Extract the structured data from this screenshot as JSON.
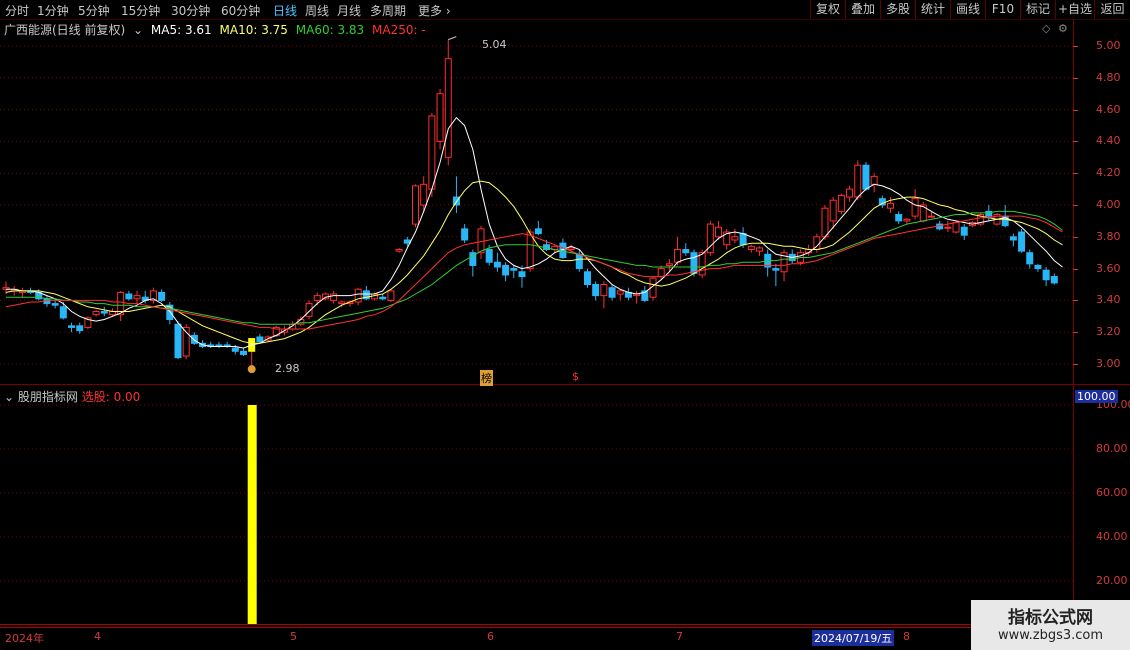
{
  "toolbar": {
    "periods": [
      "分时",
      "1分钟",
      "5分钟",
      "15分钟",
      "30分钟",
      "60分钟",
      "日线",
      "周线",
      "月线",
      "多周期",
      "更多"
    ],
    "active_period": "日线",
    "buttons": [
      "复权",
      "叠加",
      "多股",
      "统计",
      "画线",
      "F10",
      "标记",
      "+自选",
      "返回"
    ]
  },
  "header": {
    "stock": "广西能源(日线 前复权)",
    "ma5": "MA5: 3.61",
    "ma10": "MA10: 3.75",
    "ma60": "MA60: 3.83",
    "ma250": "MA250: -"
  },
  "colors": {
    "up": "#ff2d2d",
    "down": "#29b6f6",
    "ma5": "#ffffff",
    "ma10": "#ffff66",
    "ma60": "#33cc33",
    "ma250": "#ff3030",
    "axis": "#d23c3c",
    "signal": "#ffff00"
  },
  "main_chart": {
    "y_ticks": [
      "5.00",
      "4.80",
      "4.60",
      "4.40",
      "4.20",
      "4.00",
      "3.80",
      "3.60",
      "3.40",
      "3.20",
      "3.00"
    ],
    "high_label": "5.04",
    "low_label": "2.98",
    "markers": [
      "榜",
      "$"
    ]
  },
  "indicator": {
    "name": "股朋指标网",
    "value": "选股: 0.00",
    "current_badge": "100.00",
    "y_ticks": [
      "100.00",
      "80.00",
      "60.00",
      "40.00",
      "20.00"
    ]
  },
  "x_axis": {
    "labels": [
      "2024年",
      "4",
      "5",
      "6",
      "7",
      "8"
    ],
    "cursor_date": "2024/07/19/五"
  },
  "watermark": {
    "line1": "指标公式网",
    "line2": "www.zbgs3.com"
  },
  "chart_data": {
    "type": "candlestick",
    "ylim": [
      2.95,
      5.1
    ],
    "ohlc": [
      [
        3.47,
        3.52,
        3.44,
        3.48
      ],
      [
        3.46,
        3.49,
        3.43,
        3.47
      ],
      [
        3.45,
        3.48,
        3.42,
        3.46
      ],
      [
        3.46,
        3.48,
        3.44,
        3.45
      ],
      [
        3.45,
        3.47,
        3.4,
        3.41
      ],
      [
        3.41,
        3.43,
        3.36,
        3.38
      ],
      [
        3.38,
        3.41,
        3.35,
        3.37
      ],
      [
        3.36,
        3.39,
        3.28,
        3.29
      ],
      [
        3.24,
        3.26,
        3.2,
        3.23
      ],
      [
        3.24,
        3.26,
        3.19,
        3.21
      ],
      [
        3.23,
        3.3,
        3.22,
        3.29
      ],
      [
        3.31,
        3.34,
        3.3,
        3.33
      ],
      [
        3.33,
        3.36,
        3.3,
        3.32
      ],
      [
        3.31,
        3.35,
        3.3,
        3.33
      ],
      [
        3.31,
        3.46,
        3.27,
        3.45
      ],
      [
        3.44,
        3.46,
        3.4,
        3.41
      ],
      [
        3.41,
        3.46,
        3.38,
        3.43
      ],
      [
        3.42,
        3.46,
        3.38,
        3.4
      ],
      [
        3.4,
        3.48,
        3.38,
        3.46
      ],
      [
        3.45,
        3.47,
        3.39,
        3.4
      ],
      [
        3.37,
        3.39,
        3.25,
        3.28
      ],
      [
        3.25,
        3.27,
        3.03,
        3.04
      ],
      [
        3.05,
        3.25,
        3.03,
        3.23
      ],
      [
        3.18,
        3.2,
        3.12,
        3.13
      ],
      [
        3.13,
        3.15,
        3.1,
        3.11
      ],
      [
        3.12,
        3.14,
        3.1,
        3.11
      ],
      [
        3.12,
        3.14,
        3.1,
        3.11
      ],
      [
        3.12,
        3.14,
        3.1,
        3.11
      ],
      [
        3.1,
        3.12,
        3.06,
        3.08
      ],
      [
        3.08,
        3.1,
        3.05,
        3.06
      ],
      [
        3.08,
        3.16,
        2.98,
        3.16
      ],
      [
        3.17,
        3.19,
        3.13,
        3.14
      ],
      [
        3.15,
        3.18,
        3.14,
        3.17
      ],
      [
        3.18,
        3.24,
        3.17,
        3.23
      ],
      [
        3.2,
        3.24,
        3.18,
        3.22
      ],
      [
        3.22,
        3.27,
        3.21,
        3.25
      ],
      [
        3.25,
        3.3,
        3.24,
        3.28
      ],
      [
        3.3,
        3.4,
        3.28,
        3.38
      ],
      [
        3.4,
        3.45,
        3.37,
        3.43
      ],
      [
        3.41,
        3.45,
        3.4,
        3.44
      ],
      [
        3.4,
        3.46,
        3.38,
        3.44
      ],
      [
        3.38,
        3.4,
        3.36,
        3.39
      ],
      [
        3.38,
        3.4,
        3.36,
        3.39
      ],
      [
        3.39,
        3.48,
        3.37,
        3.47
      ],
      [
        3.46,
        3.49,
        3.4,
        3.41
      ],
      [
        3.41,
        3.45,
        3.4,
        3.44
      ],
      [
        3.42,
        3.44,
        3.4,
        3.41
      ],
      [
        3.4,
        3.47,
        3.39,
        3.46
      ],
      [
        3.71,
        3.73,
        3.7,
        3.72
      ],
      [
        3.78,
        3.8,
        3.74,
        3.76
      ],
      [
        3.88,
        4.13,
        3.86,
        4.12
      ],
      [
        4.0,
        4.18,
        3.95,
        4.13
      ],
      [
        4.1,
        4.58,
        4.05,
        4.56
      ],
      [
        4.4,
        4.73,
        4.35,
        4.7
      ],
      [
        4.3,
        5.04,
        4.25,
        4.92
      ],
      [
        4.05,
        4.18,
        3.95,
        4.0
      ],
      [
        3.85,
        3.88,
        3.76,
        3.78
      ],
      [
        3.7,
        3.72,
        3.55,
        3.62
      ],
      [
        3.7,
        3.87,
        3.66,
        3.85
      ],
      [
        3.72,
        3.75,
        3.62,
        3.64
      ],
      [
        3.64,
        3.7,
        3.58,
        3.61
      ],
      [
        3.62,
        3.64,
        3.52,
        3.56
      ],
      [
        3.6,
        3.62,
        3.54,
        3.59
      ],
      [
        3.58,
        3.62,
        3.48,
        3.55
      ],
      [
        3.6,
        3.85,
        3.58,
        3.83
      ],
      [
        3.85,
        3.9,
        3.81,
        3.82
      ],
      [
        3.75,
        3.78,
        3.71,
        3.72
      ],
      [
        3.72,
        3.75,
        3.7,
        3.74
      ],
      [
        3.76,
        3.79,
        3.66,
        3.67
      ],
      [
        3.72,
        3.75,
        3.7,
        3.73
      ],
      [
        3.69,
        3.72,
        3.58,
        3.6
      ],
      [
        3.58,
        3.6,
        3.48,
        3.5
      ],
      [
        3.5,
        3.52,
        3.4,
        3.43
      ],
      [
        3.43,
        3.52,
        3.35,
        3.5
      ],
      [
        3.48,
        3.5,
        3.4,
        3.42
      ],
      [
        3.44,
        3.47,
        3.4,
        3.46
      ],
      [
        3.45,
        3.48,
        3.4,
        3.42
      ],
      [
        3.43,
        3.46,
        3.38,
        3.44
      ],
      [
        3.46,
        3.49,
        3.39,
        3.4
      ],
      [
        3.42,
        3.55,
        3.4,
        3.54
      ],
      [
        3.55,
        3.62,
        3.53,
        3.6
      ],
      [
        3.62,
        3.66,
        3.58,
        3.63
      ],
      [
        3.64,
        3.8,
        3.62,
        3.72
      ],
      [
        3.72,
        3.76,
        3.68,
        3.7
      ],
      [
        3.7,
        3.72,
        3.55,
        3.57
      ],
      [
        3.56,
        3.72,
        3.54,
        3.7
      ],
      [
        3.7,
        3.9,
        3.68,
        3.88
      ],
      [
        3.8,
        3.9,
        3.78,
        3.86
      ],
      [
        3.75,
        3.85,
        3.72,
        3.83
      ],
      [
        3.78,
        3.85,
        3.76,
        3.8
      ],
      [
        3.82,
        3.86,
        3.73,
        3.75
      ],
      [
        3.72,
        3.75,
        3.7,
        3.74
      ],
      [
        3.71,
        3.74,
        3.68,
        3.73
      ],
      [
        3.69,
        3.72,
        3.55,
        3.61
      ],
      [
        3.6,
        3.63,
        3.49,
        3.59
      ],
      [
        3.58,
        3.72,
        3.52,
        3.7
      ],
      [
        3.69,
        3.72,
        3.63,
        3.65
      ],
      [
        3.64,
        3.72,
        3.62,
        3.7
      ],
      [
        3.7,
        3.75,
        3.68,
        3.72
      ],
      [
        3.72,
        3.82,
        3.7,
        3.8
      ],
      [
        3.8,
        4.0,
        3.78,
        3.98
      ],
      [
        3.9,
        4.05,
        3.85,
        4.03
      ],
      [
        3.96,
        4.07,
        3.94,
        4.06
      ],
      [
        4.05,
        4.12,
        4.02,
        4.1
      ],
      [
        4.05,
        4.28,
        4.03,
        4.25
      ],
      [
        4.25,
        4.27,
        4.09,
        4.1
      ],
      [
        4.13,
        4.2,
        4.08,
        4.18
      ],
      [
        4.04,
        4.06,
        3.98,
        4.0
      ],
      [
        3.98,
        4.05,
        3.95,
        4.01
      ],
      [
        3.94,
        3.96,
        3.88,
        3.9
      ],
      [
        3.9,
        3.92,
        3.88,
        3.91
      ],
      [
        3.93,
        4.1,
        3.91,
        4.04
      ],
      [
        3.9,
        4.02,
        3.89,
        4.0
      ],
      [
        3.93,
        3.96,
        3.92,
        3.93
      ],
      [
        3.88,
        3.9,
        3.84,
        3.85
      ],
      [
        3.86,
        3.9,
        3.83,
        3.86
      ],
      [
        3.83,
        3.9,
        3.82,
        3.89
      ],
      [
        3.86,
        3.88,
        3.78,
        3.81
      ],
      [
        3.87,
        3.9,
        3.86,
        3.89
      ],
      [
        3.88,
        3.95,
        3.87,
        3.94
      ],
      [
        3.96,
        4.0,
        3.9,
        3.93
      ],
      [
        3.88,
        3.95,
        3.87,
        3.94
      ],
      [
        3.93,
        4.0,
        3.86,
        3.87
      ],
      [
        3.8,
        3.82,
        3.74,
        3.78
      ],
      [
        3.83,
        3.85,
        3.7,
        3.71
      ],
      [
        3.7,
        3.72,
        3.6,
        3.63
      ],
      [
        3.62,
        3.63,
        3.58,
        3.6
      ],
      [
        3.59,
        3.61,
        3.49,
        3.53
      ],
      [
        3.55,
        3.57,
        3.5,
        3.51
      ]
    ],
    "ma5": [
      3.47,
      3.47,
      3.46,
      3.46,
      3.45,
      3.43,
      3.41,
      3.38,
      3.33,
      3.3,
      3.28,
      3.27,
      3.28,
      3.3,
      3.32,
      3.35,
      3.37,
      3.4,
      3.41,
      3.38,
      3.33,
      3.26,
      3.2,
      3.15,
      3.12,
      3.11,
      3.11,
      3.11,
      3.11,
      3.1,
      3.12,
      3.13,
      3.16,
      3.18,
      3.21,
      3.24,
      3.28,
      3.33,
      3.38,
      3.42,
      3.43,
      3.43,
      3.43,
      3.44,
      3.44,
      3.44,
      3.46,
      3.53,
      3.62,
      3.73,
      3.83,
      3.96,
      4.1,
      4.27,
      4.48,
      4.55,
      4.5,
      4.35,
      4.1,
      3.88,
      3.74,
      3.66,
      3.62,
      3.6,
      3.61,
      3.63,
      3.66,
      3.7,
      3.72,
      3.74,
      3.72,
      3.66,
      3.6,
      3.55,
      3.5,
      3.47,
      3.45,
      3.44,
      3.45,
      3.49,
      3.53,
      3.58,
      3.64,
      3.66,
      3.67,
      3.69,
      3.74,
      3.79,
      3.82,
      3.83,
      3.82,
      3.8,
      3.78,
      3.73,
      3.69,
      3.68,
      3.67,
      3.68,
      3.7,
      3.74,
      3.8,
      3.86,
      3.92,
      3.98,
      4.05,
      4.1,
      4.13,
      4.12,
      4.1,
      4.07,
      4.03,
      4.0,
      3.99,
      3.96,
      3.93,
      3.91,
      3.9,
      3.89,
      3.88,
      3.89,
      3.9,
      3.91,
      3.92,
      3.9,
      3.86,
      3.81,
      3.76,
      3.71,
      3.65,
      3.61
    ],
    "ma10": [
      3.45,
      3.46,
      3.46,
      3.46,
      3.46,
      3.45,
      3.44,
      3.42,
      3.4,
      3.38,
      3.36,
      3.35,
      3.34,
      3.33,
      3.33,
      3.33,
      3.34,
      3.35,
      3.36,
      3.37,
      3.36,
      3.33,
      3.3,
      3.27,
      3.24,
      3.22,
      3.2,
      3.18,
      3.16,
      3.14,
      3.13,
      3.13,
      3.14,
      3.15,
      3.16,
      3.18,
      3.2,
      3.23,
      3.27,
      3.31,
      3.34,
      3.37,
      3.39,
      3.41,
      3.42,
      3.43,
      3.44,
      3.47,
      3.51,
      3.56,
      3.62,
      3.68,
      3.76,
      3.84,
      3.94,
      4.02,
      4.09,
      4.14,
      4.15,
      4.14,
      4.1,
      4.05,
      3.99,
      3.91,
      3.82,
      3.74,
      3.69,
      3.66,
      3.65,
      3.65,
      3.66,
      3.66,
      3.65,
      3.63,
      3.61,
      3.58,
      3.56,
      3.53,
      3.51,
      3.5,
      3.49,
      3.5,
      3.52,
      3.54,
      3.57,
      3.6,
      3.63,
      3.66,
      3.7,
      3.73,
      3.75,
      3.76,
      3.76,
      3.76,
      3.75,
      3.74,
      3.74,
      3.73,
      3.72,
      3.72,
      3.73,
      3.75,
      3.79,
      3.83,
      3.88,
      3.93,
      3.98,
      4.01,
      4.03,
      4.04,
      4.05,
      4.05,
      4.04,
      4.02,
      4.0,
      3.99,
      3.97,
      3.96,
      3.94,
      3.93,
      3.92,
      3.91,
      3.91,
      3.9,
      3.89,
      3.87,
      3.85,
      3.82,
      3.78,
      3.75
    ],
    "ma60": [
      3.42,
      3.42,
      3.42,
      3.42,
      3.42,
      3.41,
      3.41,
      3.4,
      3.4,
      3.39,
      3.39,
      3.38,
      3.38,
      3.37,
      3.37,
      3.37,
      3.36,
      3.36,
      3.36,
      3.35,
      3.35,
      3.34,
      3.33,
      3.32,
      3.31,
      3.3,
      3.29,
      3.28,
      3.27,
      3.26,
      3.26,
      3.25,
      3.25,
      3.25,
      3.25,
      3.25,
      3.26,
      3.26,
      3.27,
      3.28,
      3.29,
      3.3,
      3.31,
      3.32,
      3.33,
      3.34,
      3.35,
      3.37,
      3.39,
      3.41,
      3.44,
      3.47,
      3.5,
      3.54,
      3.58,
      3.62,
      3.65,
      3.68,
      3.71,
      3.73,
      3.74,
      3.75,
      3.75,
      3.75,
      3.75,
      3.74,
      3.73,
      3.72,
      3.71,
      3.7,
      3.69,
      3.68,
      3.67,
      3.66,
      3.65,
      3.64,
      3.63,
      3.62,
      3.62,
      3.61,
      3.61,
      3.61,
      3.61,
      3.61,
      3.61,
      3.61,
      3.62,
      3.62,
      3.63,
      3.63,
      3.64,
      3.64,
      3.64,
      3.65,
      3.65,
      3.66,
      3.66,
      3.67,
      3.67,
      3.68,
      3.69,
      3.7,
      3.72,
      3.74,
      3.76,
      3.78,
      3.8,
      3.82,
      3.84,
      3.86,
      3.88,
      3.89,
      3.9,
      3.91,
      3.92,
      3.93,
      3.94,
      3.94,
      3.95,
      3.95,
      3.95,
      3.96,
      3.96,
      3.96,
      3.95,
      3.94,
      3.93,
      3.91,
      3.88,
      3.84
    ],
    "ma250": [
      3.36,
      3.37,
      3.38,
      3.39,
      3.39,
      3.4,
      3.4,
      3.4,
      3.4,
      3.4,
      3.4,
      3.4,
      3.4,
      3.39,
      3.39,
      3.38,
      3.38,
      3.37,
      3.36,
      3.35,
      3.34,
      3.33,
      3.32,
      3.31,
      3.3,
      3.29,
      3.28,
      3.27,
      3.26,
      3.25,
      3.24,
      3.23,
      3.23,
      3.22,
      3.22,
      3.22,
      3.22,
      3.22,
      3.23,
      3.24,
      3.25,
      3.26,
      3.27,
      3.28,
      3.3,
      3.31,
      3.33,
      3.36,
      3.4,
      3.45,
      3.5,
      3.55,
      3.6,
      3.65,
      3.7,
      3.73,
      3.75,
      3.76,
      3.77,
      3.78,
      3.79,
      3.8,
      3.81,
      3.82,
      3.81,
      3.79,
      3.77,
      3.75,
      3.73,
      3.71,
      3.69,
      3.67,
      3.65,
      3.63,
      3.61,
      3.59,
      3.57,
      3.56,
      3.55,
      3.55,
      3.55,
      3.56,
      3.56,
      3.57,
      3.58,
      3.59,
      3.6,
      3.6,
      3.61,
      3.62,
      3.62,
      3.62,
      3.62,
      3.62,
      3.62,
      3.62,
      3.63,
      3.63,
      3.64,
      3.65,
      3.67,
      3.69,
      3.71,
      3.73,
      3.75,
      3.77,
      3.79,
      3.8,
      3.81,
      3.82,
      3.83,
      3.84,
      3.85,
      3.86,
      3.87,
      3.88,
      3.89,
      3.9,
      3.91,
      3.92,
      3.92,
      3.93,
      3.93,
      3.93,
      3.93,
      3.92,
      3.91,
      3.89,
      3.86,
      3.83
    ],
    "signal_index": 30,
    "indicator_ylim": [
      0,
      100
    ],
    "signal_value": 100
  }
}
